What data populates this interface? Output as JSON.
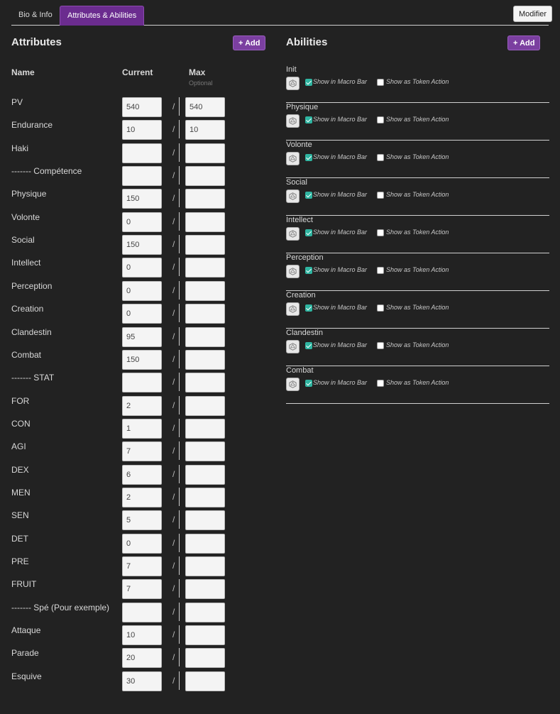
{
  "tabs": [
    {
      "label": "Bio & Info"
    },
    {
      "label": "Attributes & Abilities"
    }
  ],
  "edit_button": "Modifier",
  "attributes": {
    "title": "Attributes",
    "add_label": "+ Add",
    "headers": {
      "name": "Name",
      "current": "Current",
      "max": "Max",
      "max_hint": "Optional"
    },
    "separator": "/",
    "rows": [
      {
        "name": "PV",
        "current": "540",
        "max": "540"
      },
      {
        "name": "Endurance",
        "current": "10",
        "max": "10"
      },
      {
        "name": "Haki",
        "current": "",
        "max": ""
      },
      {
        "name": "------- Compétence",
        "current": "",
        "max": ""
      },
      {
        "name": "Physique",
        "current": "150",
        "max": ""
      },
      {
        "name": "Volonte",
        "current": "0",
        "max": ""
      },
      {
        "name": "Social",
        "current": "150",
        "max": ""
      },
      {
        "name": "Intellect",
        "current": "0",
        "max": ""
      },
      {
        "name": "Perception",
        "current": "0",
        "max": ""
      },
      {
        "name": "Creation",
        "current": "0",
        "max": ""
      },
      {
        "name": "Clandestin",
        "current": "95",
        "max": ""
      },
      {
        "name": "Combat",
        "current": "150",
        "max": ""
      },
      {
        "name": "------- STAT",
        "current": "",
        "max": ""
      },
      {
        "name": "FOR",
        "current": "2",
        "max": ""
      },
      {
        "name": "CON",
        "current": "1",
        "max": ""
      },
      {
        "name": "AGI",
        "current": "7",
        "max": ""
      },
      {
        "name": "DEX",
        "current": "6",
        "max": ""
      },
      {
        "name": "MEN",
        "current": "2",
        "max": ""
      },
      {
        "name": "SEN",
        "current": "5",
        "max": ""
      },
      {
        "name": "DET",
        "current": "0",
        "max": ""
      },
      {
        "name": "PRE",
        "current": "7",
        "max": ""
      },
      {
        "name": "FRUIT",
        "current": "7",
        "max": ""
      },
      {
        "name": "------- Spé (Pour exemple)",
        "current": "",
        "max": ""
      },
      {
        "name": "Attaque",
        "current": "10",
        "max": ""
      },
      {
        "name": "Parade",
        "current": "20",
        "max": ""
      },
      {
        "name": "Esquive",
        "current": "30",
        "max": ""
      }
    ]
  },
  "abilities": {
    "title": "Abilities",
    "add_label": "+ Add",
    "macro_label": "Show in Macro Bar",
    "token_label": "Show as Token Action",
    "items": [
      {
        "name": "Init",
        "macro": true,
        "token": false
      },
      {
        "name": "Physique",
        "macro": true,
        "token": false
      },
      {
        "name": "Volonte",
        "macro": true,
        "token": false
      },
      {
        "name": "Social",
        "macro": true,
        "token": false
      },
      {
        "name": "Intellect",
        "macro": true,
        "token": false
      },
      {
        "name": "Perception",
        "macro": true,
        "token": false
      },
      {
        "name": "Creation",
        "macro": true,
        "token": false
      },
      {
        "name": "Clandestin",
        "macro": true,
        "token": false
      },
      {
        "name": "Combat",
        "macro": true,
        "token": false
      }
    ]
  },
  "colors": {
    "background": "#222222",
    "accent": "#6b2c8f",
    "check": "#2fb5a1"
  }
}
